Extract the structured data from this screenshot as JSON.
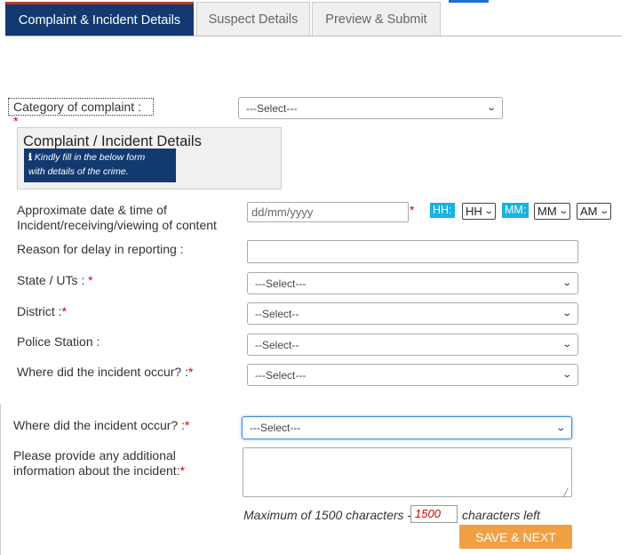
{
  "tabs": [
    {
      "label": "Complaint & Incident Details"
    },
    {
      "label": "Suspect Details"
    },
    {
      "label": "Preview & Submit"
    }
  ],
  "category": {
    "label": "Category of complaint : ",
    "required": "*",
    "value": "---Select---"
  },
  "panel": {
    "title": "Complaint / Incident Details",
    "note_icon": "ℹ",
    "note_line1": "Kindly fill in the below form",
    "note_line2": "with details of the crime."
  },
  "datetime": {
    "label_line1": "Approximate date & time of",
    "label_line2": "Incident/receiving/viewing of content",
    "date_placeholder": "dd/mm/yyyy",
    "required": "*",
    "hh_label": "HH:",
    "hh_value": "HH",
    "mm_label": "MM:",
    "mm_value": "MM",
    "ampm_value": "AM"
  },
  "delay": {
    "label": "Reason for delay in reporting :"
  },
  "state": {
    "label": "State / UTs : ",
    "required": "*",
    "value": "---Select---"
  },
  "district": {
    "label": "District :",
    "required": "*",
    "value": "--Select--"
  },
  "police": {
    "label": "Police Station :",
    "value": "--Select--"
  },
  "where1": {
    "label": "Where did the incident occur? :",
    "required": "*",
    "value": "---Select---"
  },
  "where2": {
    "label": "Where did the incident occur? :",
    "required": "*",
    "value": "---Select---"
  },
  "additional": {
    "label_line1": "Please provide any additional",
    "label_line2": "information about the incident:",
    "required": "*"
  },
  "char_limit": {
    "prefix": "Maximum of 1500 characters - ",
    "count": "1500",
    "suffix": "characters left"
  },
  "submit_label": "SAVE & NEXT"
}
